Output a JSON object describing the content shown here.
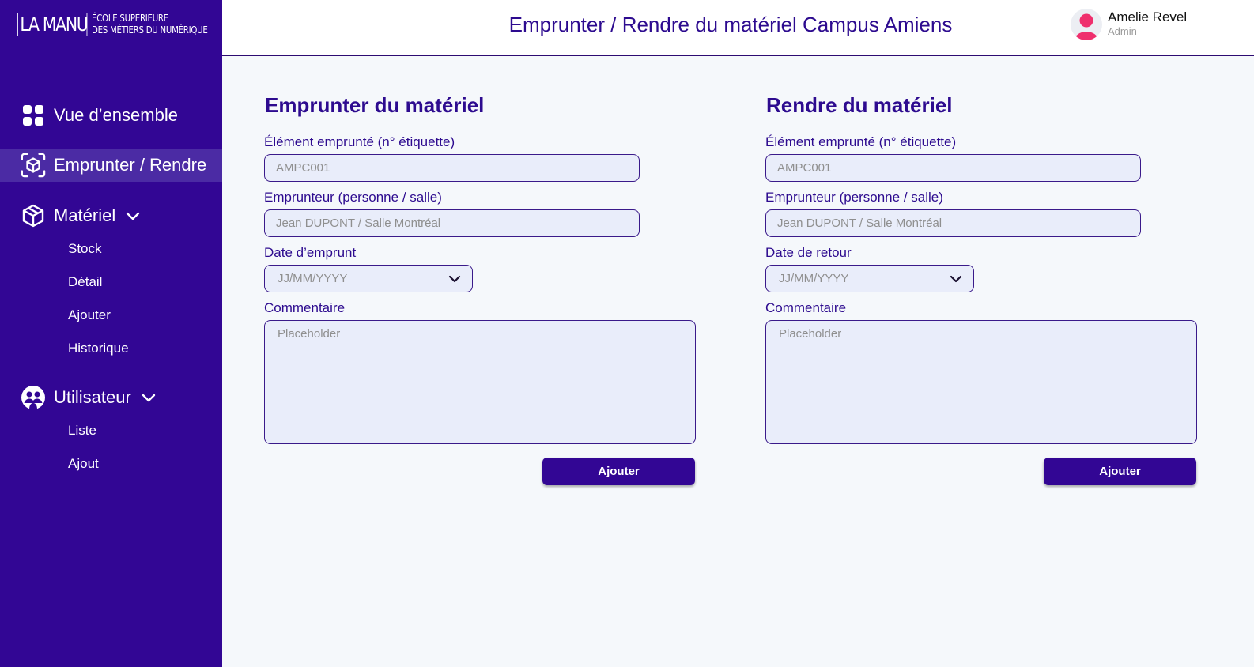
{
  "brand": {
    "logo_main": "LA MANU",
    "logo_line1": "ÉCOLE SUPÉRIEURE",
    "logo_line2": "DES MÉTIERS DU NUMÉRIQUE"
  },
  "sidebar": {
    "items": [
      {
        "label": "Vue d’ensemble",
        "icon": "grid-icon"
      },
      {
        "label": "Emprunter / Rendre",
        "icon": "scan-box-icon",
        "active": true
      },
      {
        "label": "Matériel",
        "icon": "box-icon",
        "sub": [
          "Stock",
          "Détail",
          "Ajouter",
          "Historique"
        ]
      },
      {
        "label": "Utilisateur",
        "icon": "users-icon",
        "sub": [
          "Liste",
          "Ajout"
        ]
      }
    ]
  },
  "header": {
    "title": "Emprunter / Rendre du matériel Campus Amiens",
    "user_name": "Amelie Revel",
    "user_role": "Admin"
  },
  "borrow": {
    "title": "Emprunter du matériel",
    "item_label": "Élément emprunté (n° étiquette)",
    "item_placeholder": "AMPC001",
    "borrower_label": "Emprunteur (personne / salle)",
    "borrower_placeholder": "Jean DUPONT / Salle Montréal",
    "date_label": "Date d’emprunt",
    "date_placeholder": "JJ/MM/YYYY",
    "comment_label": "Commentaire",
    "comment_placeholder": "Placeholder",
    "button": "Ajouter"
  },
  "return": {
    "title": "Rendre du matériel",
    "item_label": "Élément emprunté (n° étiquette)",
    "item_placeholder": "AMPC001",
    "borrower_label": "Emprunteur (personne / salle)",
    "borrower_placeholder": "Jean DUPONT / Salle Montréal",
    "date_label": "Date de retour",
    "date_placeholder": "JJ/MM/YYYY",
    "comment_label": "Commentaire",
    "comment_placeholder": "Placeholder",
    "button": "Ajouter"
  },
  "colors": {
    "primary": "#320694",
    "active_nav": "#4b2ba4",
    "field_bg": "#e9edfa",
    "avatar_accent": "#ef2f6d"
  }
}
